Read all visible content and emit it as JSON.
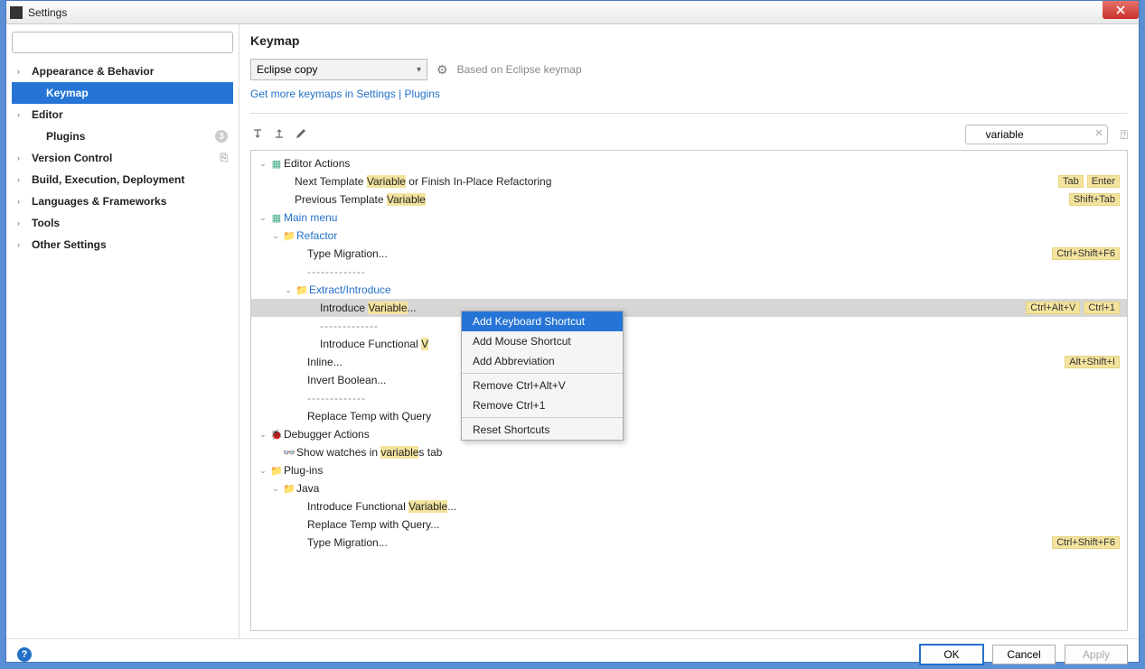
{
  "window": {
    "title": "Settings",
    "dim_text": ""
  },
  "sidebar": {
    "search_placeholder": "",
    "items": [
      {
        "label": "Appearance & Behavior",
        "expandable": true,
        "bold": true
      },
      {
        "label": "Keymap",
        "selected": true,
        "indent": true,
        "bold": true
      },
      {
        "label": "Editor",
        "expandable": true,
        "bold": true
      },
      {
        "label": "Plugins",
        "indent": true,
        "bold": true,
        "badge": "3"
      },
      {
        "label": "Version Control",
        "expandable": true,
        "bold": true,
        "vcs": true
      },
      {
        "label": "Build, Execution, Deployment",
        "expandable": true,
        "bold": true
      },
      {
        "label": "Languages & Frameworks",
        "expandable": true,
        "bold": true
      },
      {
        "label": "Tools",
        "expandable": true,
        "bold": true
      },
      {
        "label": "Other Settings",
        "expandable": true,
        "bold": true
      }
    ]
  },
  "main": {
    "heading": "Keymap",
    "combo_value": "Eclipse copy",
    "based_on": "Based on Eclipse keymap",
    "link_text": "Get more keymaps in Settings | Plugins",
    "search_value": "variable"
  },
  "tree": {
    "editor_actions": "Editor Actions",
    "next_tpl_pre": "Next Template ",
    "next_tpl_hl": "Variable",
    "next_tpl_post": " or Finish In-Place Refactoring",
    "next_tpl_sc": [
      "Tab",
      "Enter"
    ],
    "prev_tpl_pre": "Previous Template ",
    "prev_tpl_hl": "Variable",
    "prev_tpl_sc": [
      "Shift+Tab"
    ],
    "main_menu": "Main menu",
    "refactor": "Refactor",
    "type_migration": "Type Migration...",
    "type_migration_sc": [
      "Ctrl+Shift+F6"
    ],
    "dash": "-------------",
    "extract": "Extract/Introduce",
    "introduce_pre": "Introduce ",
    "introduce_hl": "Variable",
    "introduce_post": "...",
    "introduce_sc": [
      "Ctrl+Alt+V",
      "Ctrl+1"
    ],
    "introduce_func_pre": "Introduce Functional ",
    "introduce_func_hl": "V",
    "inline": "Inline...",
    "inline_sc": [
      "Alt+Shift+I"
    ],
    "invert": "Invert Boolean...",
    "replace_temp": "Replace Temp with Query",
    "debugger_actions": "Debugger Actions",
    "watches_pre": "Show watches in ",
    "watches_hl": "variable",
    "watches_post": "s tab",
    "plugins": "Plug-ins",
    "java": "Java",
    "jintro_pre": "Introduce Functional ",
    "jintro_hl": "Variable",
    "jintro_post": "...",
    "jreplace": "Replace Temp with Query...",
    "jtype": "Type Migration...",
    "jtype_sc": [
      "Ctrl+Shift+F6"
    ]
  },
  "context_menu": {
    "items": [
      {
        "label": "Add Keyboard Shortcut",
        "selected": true
      },
      {
        "label": "Add Mouse Shortcut"
      },
      {
        "label": "Add Abbreviation"
      },
      {
        "sep": true
      },
      {
        "label": "Remove Ctrl+Alt+V"
      },
      {
        "label": "Remove Ctrl+1"
      },
      {
        "sep": true
      },
      {
        "label": "Reset Shortcuts"
      }
    ]
  },
  "footer": {
    "ok": "OK",
    "cancel": "Cancel",
    "apply": "Apply"
  }
}
